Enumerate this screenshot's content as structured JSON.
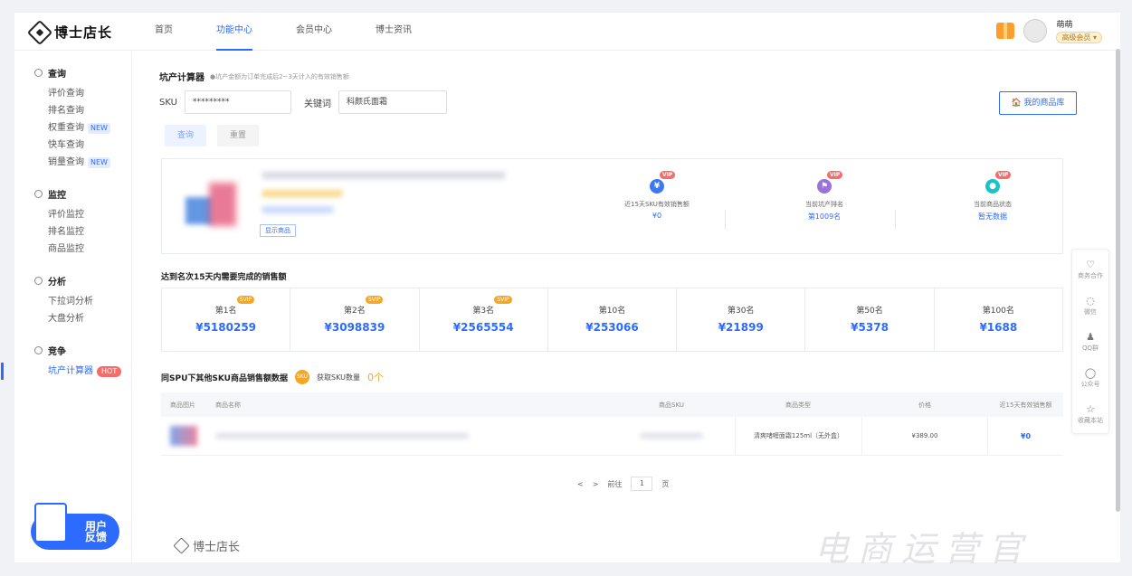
{
  "header": {
    "logo_text": "博士店长",
    "nav": [
      "首页",
      "功能中心",
      "会员中心",
      "博士资讯"
    ],
    "user_name": "萌萌",
    "member_badge": "高级会员 ▾"
  },
  "sidebar": {
    "groups": [
      {
        "title": "查询",
        "items": [
          {
            "label": "评价查询"
          },
          {
            "label": "排名查询"
          },
          {
            "label": "权重查询",
            "tag": "NEW"
          },
          {
            "label": "快车查询"
          },
          {
            "label": "销量查询",
            "tag": "NEW"
          }
        ]
      },
      {
        "title": "监控",
        "items": [
          {
            "label": "评价监控"
          },
          {
            "label": "排名监控"
          },
          {
            "label": "商品监控"
          }
        ]
      },
      {
        "title": "分析",
        "items": [
          {
            "label": "下拉词分析"
          },
          {
            "label": "大盘分析"
          }
        ]
      },
      {
        "title": "竞争",
        "items": [
          {
            "label": "坑产计算器",
            "tag": "HOT"
          }
        ]
      }
    ],
    "feedback": [
      "用户",
      "反馈"
    ]
  },
  "calculator": {
    "title": "坑产计算器",
    "hint": "●坑产金额为订单完成后2~3天计入的有效销售额",
    "sku_label": "SKU",
    "sku_value": "*********",
    "keyword_label": "关键词",
    "keyword_value": "科颜氏面霜",
    "query_btn": "查询",
    "reset_btn": "重置",
    "library_btn": "🏠 我的商品库"
  },
  "product": {
    "show_btn": "显示商品",
    "stats": [
      {
        "label": "近15天SKU有效销售额",
        "value": "¥0",
        "icon": "¥",
        "color": "#3b78f2",
        "vip": "VIP"
      },
      {
        "label": "当前坑产排名",
        "value": "第1009名",
        "icon": "⚑",
        "color": "#9a72d9",
        "vip": "VIP"
      },
      {
        "label": "当前商品状态",
        "value": "暂无数据",
        "icon": "●",
        "color": "#19c3c9",
        "vip": "VIP"
      }
    ]
  },
  "ranking": {
    "title": "达到名次15天内需要完成的销售额",
    "cells": [
      {
        "label": "第1名",
        "value": "¥5180259",
        "svip": "SVIP"
      },
      {
        "label": "第2名",
        "value": "¥3098839",
        "svip": "SVIP"
      },
      {
        "label": "第3名",
        "value": "¥2565554",
        "svip": "SVIP"
      },
      {
        "label": "第10名",
        "value": "¥253066"
      },
      {
        "label": "第30名",
        "value": "¥21899"
      },
      {
        "label": "第50名",
        "value": "¥5378"
      },
      {
        "label": "第100名",
        "value": "¥1688"
      }
    ]
  },
  "spu": {
    "title": "同SPU下其他SKU商品销售额数据",
    "sku_circle": "SKU",
    "count_label": "获取SKU数量",
    "count_value": "0个",
    "columns": [
      "商品图片",
      "商品名称",
      "商品SKU",
      "商品类型",
      "价格",
      "近15天有效销售额"
    ],
    "row": {
      "type": "清爽啫喱面霜125ml（无外盒）",
      "price": "¥389.00",
      "sales": "¥0"
    }
  },
  "pager": {
    "prev": "<",
    "next": ">",
    "goto": "前往",
    "page": "1",
    "unit": "页"
  },
  "footer": {
    "logo_text": "博士店长"
  },
  "float_bar": [
    {
      "icon": "♡",
      "label": "商务合作"
    },
    {
      "icon": "◌",
      "label": "微信"
    },
    {
      "icon": "♟",
      "label": "QQ群"
    },
    {
      "icon": "◯",
      "label": "公众号"
    },
    {
      "icon": "☆",
      "label": "收藏本站"
    }
  ],
  "watermark": "电商运营官"
}
